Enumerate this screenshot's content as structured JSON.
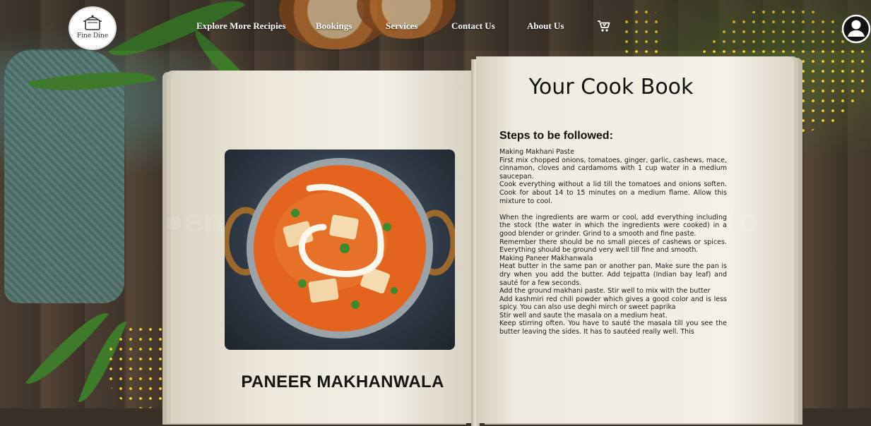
{
  "nav": {
    "logo_text": "Fine Dine",
    "links": [
      "Explore More Recipies",
      "Bookings",
      "Services",
      "Contact Us",
      "About Us"
    ],
    "cart_icon": "cart-icon",
    "profile_icon": "user-profile-icon"
  },
  "book": {
    "heading": "Your Cook Book",
    "dish_name": "PANEER MAKHANWALA",
    "steps_heading": "Steps to be followed:",
    "steps": [
      "Making Makhani Paste",
      "First mix chopped onions, tomatoes, ginger, garlic, cashews, mace, cinnamon, cloves and cardamoms with 1 cup water in a medium saucepan.",
      "Cook everything without a lid till the tomatoes and onions soften. Cook for about 14 to 15 minutes on a medium flame. Allow this mixture to cool.",
      "When the ingredients are warm or cool, add everything including the stock (the water in which the ingredients were cooked) in a good blender or grinder. Grind to a smooth and fine paste.",
      "Remember there should be no small pieces of cashews or spices. Everything should be ground very well till fine and smooth.",
      "Making Paneer Makhanwala",
      "Heat butter in the same pan or another pan. Make sure the pan is dry when you add the butter. Add tejpatta (Indian bay leaf) and sauté for a few seconds.",
      "Add the ground makhani paste. Stir well to mix with the butter",
      "Add kashmiri red chili powder which gives a good color and is less spicy. You can also use deghi mirch or sweet paprika",
      "Stir well and saute the masala on a medium heat.",
      "Keep stirring often. You have to sauté the masala till you see the butter leaving the sides. It has to sautéed really well. This"
    ]
  },
  "colors": {
    "nav_text": "#ffffff",
    "heading": "#111111",
    "curry": "#e2641f"
  }
}
